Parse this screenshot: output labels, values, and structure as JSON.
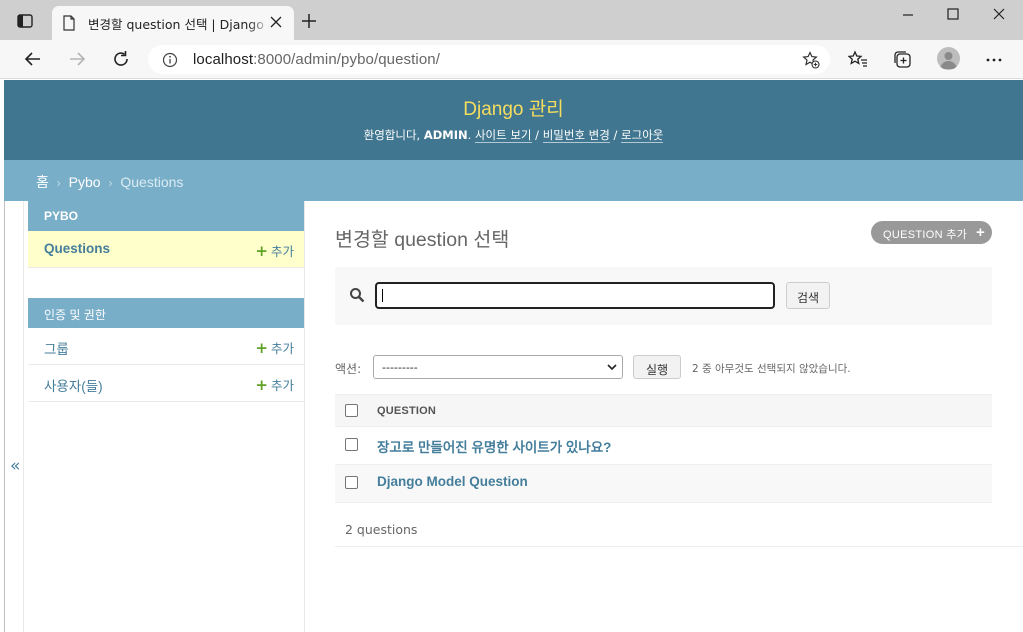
{
  "browser": {
    "tab_title": "변경할 question 선택 | Django 사이트 관리",
    "url_host": "localhost",
    "url_rest": ":8000/admin/pybo/question/"
  },
  "header": {
    "brand": "Django 관리",
    "welcome": "환영합니다,",
    "username": "ADMIN",
    "view_site": "사이트 보기",
    "change_password": "비밀번호 변경",
    "logout": "로그아웃",
    "separator": "/"
  },
  "breadcrumbs": {
    "home": "홈",
    "app": "Pybo",
    "current": "Questions",
    "sep": "›"
  },
  "sidebar": {
    "toggle": "«",
    "modules": [
      {
        "caption": "PYBO",
        "models": [
          {
            "name": "Questions",
            "add": "추가"
          }
        ]
      },
      {
        "caption": "인증 및 권한",
        "models": [
          {
            "name": "그룹",
            "add": "추가"
          },
          {
            "name": "사용자(들)",
            "add": "추가"
          }
        ]
      }
    ]
  },
  "content": {
    "title": "변경할 question 선택",
    "add_button": "QUESTION 추가",
    "search_button": "검색",
    "actions_label": "액션:",
    "actions_selected": "---------",
    "run_button": "실행",
    "action_counter": "2 중 아무것도 선택되지 않았습니다.",
    "column_header": "QUESTION",
    "rows": [
      {
        "subject": "장고로 만들어진 유명한 사이트가 있나요?"
      },
      {
        "subject": "Django Model Question"
      }
    ],
    "paginator": "2 questions"
  }
}
